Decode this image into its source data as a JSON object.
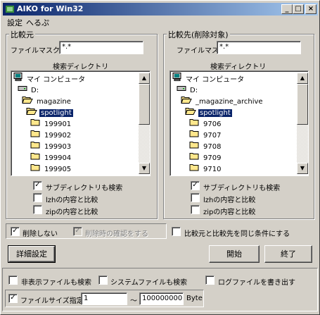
{
  "window": {
    "title": "AIKO for Win32",
    "controls": {
      "minimize": "_",
      "maximize": "□",
      "close": "×"
    }
  },
  "menu": {
    "items": [
      "設定",
      "へるぷ"
    ]
  },
  "source": {
    "group_label": "比較元",
    "mask_label": "ファイルマスク",
    "mask_value": "*.*",
    "dir_label": "検索ディレクトリ",
    "tree": [
      {
        "label": "マイ コンピュータ",
        "icon": "computer-icon",
        "indent": 0,
        "selected": false
      },
      {
        "label": "D:",
        "icon": "drive-icon",
        "indent": 1,
        "selected": false
      },
      {
        "label": "magazine",
        "icon": "folder-open-icon",
        "indent": 2,
        "selected": false
      },
      {
        "label": "spotlight",
        "icon": "folder-open-icon",
        "indent": 3,
        "selected": true
      },
      {
        "label": "199901",
        "icon": "folder-icon",
        "indent": 4,
        "selected": false
      },
      {
        "label": "199902",
        "icon": "folder-icon",
        "indent": 4,
        "selected": false
      },
      {
        "label": "199903",
        "icon": "folder-icon",
        "indent": 4,
        "selected": false
      },
      {
        "label": "199904",
        "icon": "folder-icon",
        "indent": 4,
        "selected": false
      },
      {
        "label": "199905",
        "icon": "folder-icon",
        "indent": 4,
        "selected": false
      }
    ],
    "options": [
      {
        "label": "サブディレクトリも検索",
        "checked": true
      },
      {
        "label": "lzhの内容と比較",
        "checked": false
      },
      {
        "label": "zipの内容と比較",
        "checked": false
      }
    ]
  },
  "target": {
    "group_label": "比較先(削除対象)",
    "mask_label": "ファイルマスク",
    "mask_value": "*.*",
    "dir_label": "検索ディレクトリ",
    "tree": [
      {
        "label": "マイ コンピュータ",
        "icon": "computer-icon",
        "indent": 0,
        "selected": false
      },
      {
        "label": "D:",
        "icon": "drive-icon",
        "indent": 1,
        "selected": false
      },
      {
        "label": "_magazine_archive",
        "icon": "folder-open-icon",
        "indent": 2,
        "selected": false
      },
      {
        "label": "spotlight",
        "icon": "folder-open-icon",
        "indent": 3,
        "selected": true
      },
      {
        "label": "9706",
        "icon": "folder-icon",
        "indent": 4,
        "selected": false
      },
      {
        "label": "9707",
        "icon": "folder-icon",
        "indent": 4,
        "selected": false
      },
      {
        "label": "9708",
        "icon": "folder-icon",
        "indent": 4,
        "selected": false
      },
      {
        "label": "9709",
        "icon": "folder-icon",
        "indent": 4,
        "selected": false
      },
      {
        "label": "9710",
        "icon": "folder-icon",
        "indent": 4,
        "selected": false
      }
    ],
    "options": [
      {
        "label": "サブディレクトリも検索",
        "checked": true
      },
      {
        "label": "lzhの内容と比較",
        "checked": false
      },
      {
        "label": "zipの内容と比較",
        "checked": false
      }
    ]
  },
  "middle": {
    "no_delete_label": "削除しない",
    "no_delete_checked": true,
    "confirm_delete_label": "削除時の確認をする",
    "confirm_delete_checked": true,
    "same_condition_label": "比較元と比較先を同じ条件にする",
    "same_condition_checked": false
  },
  "buttons": {
    "detail": "詳細設定",
    "start": "開始",
    "exit": "終了"
  },
  "bottom": {
    "hidden_files_label": "非表示ファイルも検索",
    "hidden_files_checked": false,
    "system_files_label": "システムファイルも検索",
    "system_files_checked": false,
    "log_file_label": "ログファイルを書き出す",
    "log_file_checked": false,
    "size_label": "ファイルサイズ指定",
    "size_checked": true,
    "size_min": "1",
    "size_sep": "～",
    "size_max": "100000000",
    "size_unit": "Byte"
  },
  "colors": {
    "title_start": "#0a246a",
    "title_end": "#a6caf0",
    "face": "#d4d0c8",
    "selection": "#0a246a",
    "folder": "#ffe78c"
  }
}
